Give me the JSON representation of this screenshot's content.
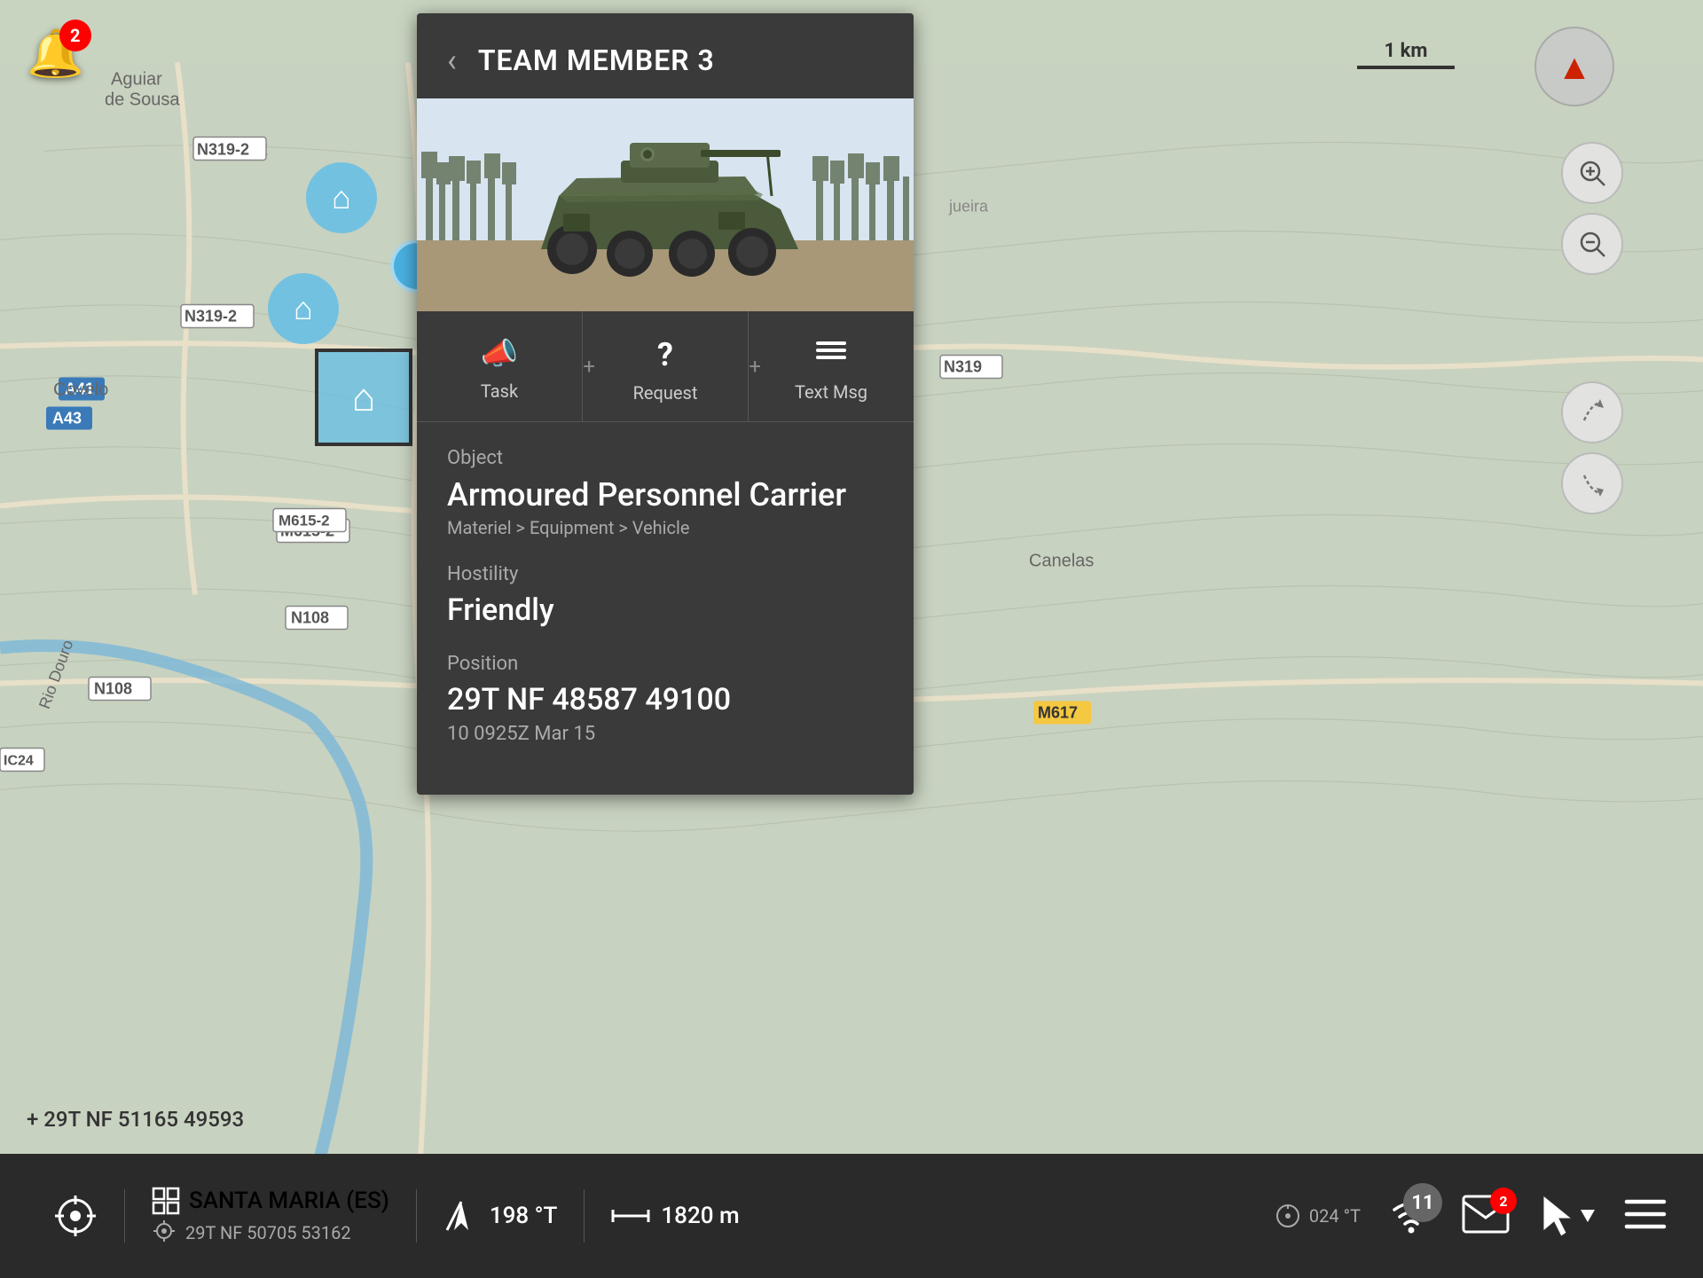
{
  "map": {
    "coordinate_display": "+ 29T NF 51165 49593",
    "scale": "1 km"
  },
  "panel": {
    "title": "TEAM MEMBER 3",
    "back_label": "‹",
    "actions": [
      {
        "icon": "📣",
        "label": "Task"
      },
      {
        "icon": "?",
        "label": "Request"
      },
      {
        "icon": "≡",
        "label": "Text Msg"
      }
    ],
    "object_label": "Object",
    "object_name": "Armoured Personnel Carrier",
    "object_path": "Materiel > Equipment > Vehicle",
    "hostility_label": "Hostility",
    "hostility_value": "Friendly",
    "position_label": "Position",
    "position_value": "29T NF 48587 49100",
    "position_time": "10 0925Z Mar 15"
  },
  "bottom_bar": {
    "gps_icon": "⊙",
    "target_icon": "⊡",
    "location_name": "SANTA MARIA (ES)",
    "location_coords": "29T NF 50705 53162",
    "heading_icon": "↗",
    "heading_value": "198 °T",
    "distance_icon": "↔",
    "distance_value": "1820 m",
    "bearing_value": "024 °T",
    "wifi_icon": "wifi",
    "mail_icon": "✉",
    "mail_badge": "2",
    "num_badge": "11",
    "cursor_icon": "▶",
    "menu_icon": "≡"
  },
  "notification": {
    "badge_count": "2"
  }
}
